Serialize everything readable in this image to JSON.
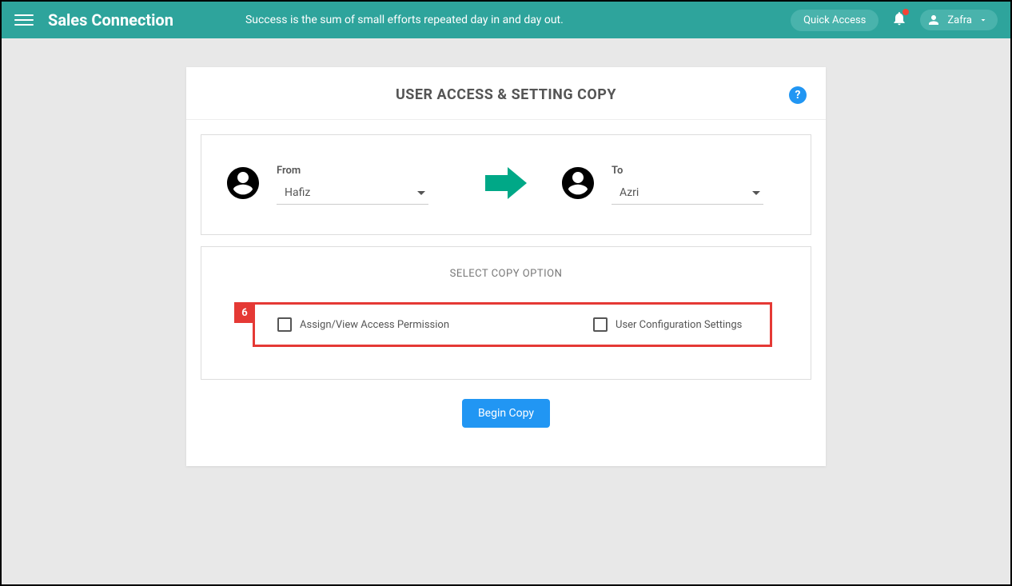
{
  "header": {
    "brand": "Sales Connection",
    "tagline": "Success is the sum of small efforts repeated day in and day out.",
    "quick_access_label": "Quick Access",
    "user_name": "Zafra"
  },
  "card": {
    "title": "USER ACCESS & SETTING COPY",
    "help_symbol": "?"
  },
  "transfer": {
    "from_label": "From",
    "from_value": "Hafiz",
    "to_label": "To",
    "to_value": "Azri"
  },
  "options": {
    "section_title": "SELECT COPY OPTION",
    "badge_number": "6",
    "option1_label": "Assign/View Access Permission",
    "option2_label": "User Configuration Settings"
  },
  "actions": {
    "begin_copy_label": "Begin Copy"
  }
}
